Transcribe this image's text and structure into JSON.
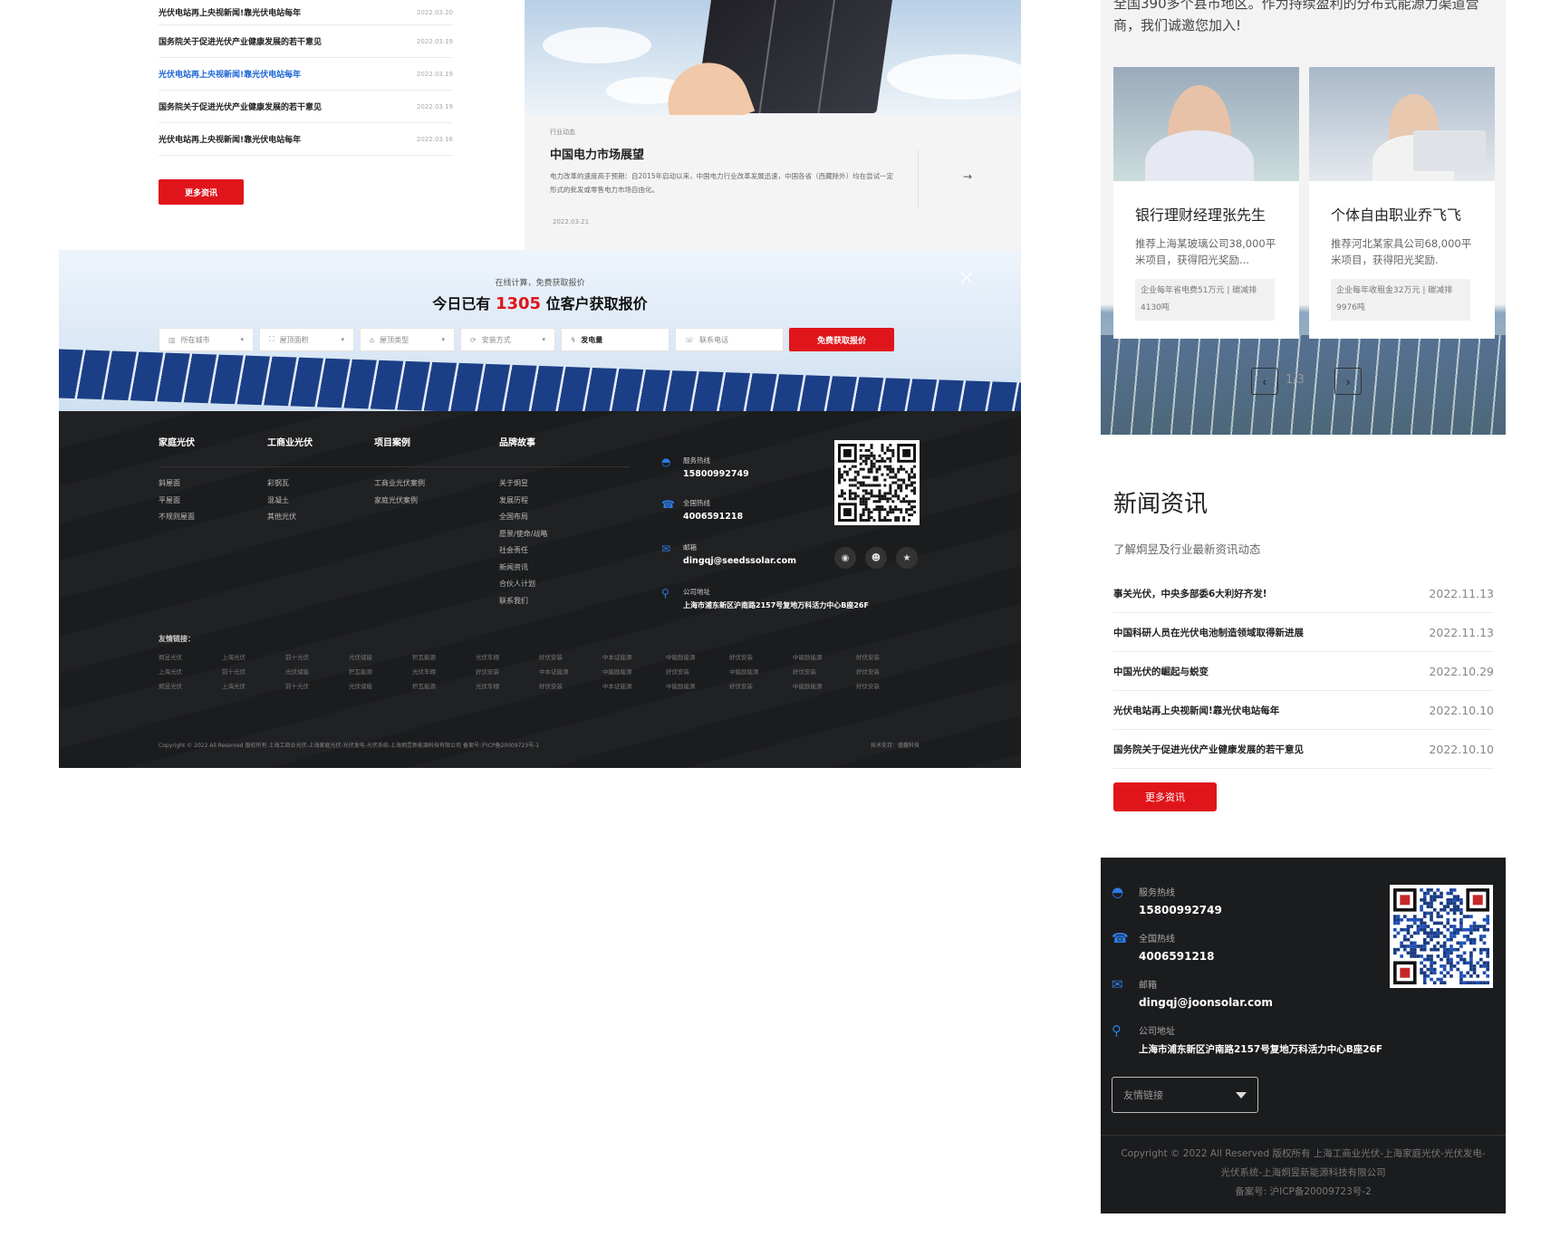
{
  "desktop": {
    "news_list": [
      {
        "title": "光伏电站再上央视新闻!靠光伏电站每年",
        "date": "2022.03.20",
        "active": false
      },
      {
        "title": "国务院关于促进光伏产业健康发展的若干意见",
        "date": "2022.03.19",
        "active": false
      },
      {
        "title": "光伏电站再上央视新闻!靠光伏电站每年",
        "date": "2022.03.19",
        "active": true
      },
      {
        "title": "国务院关于促进光伏产业健康发展的若干意见",
        "date": "2022.03.19",
        "active": false
      },
      {
        "title": "光伏电站再上央视新闻!靠光伏电站每年",
        "date": "2022.03.16",
        "active": false
      }
    ],
    "more_news_label": "更多资讯",
    "feature": {
      "tag": "行业动态",
      "title": "中国电力市场展望",
      "desc": "电力改革的速度高于预期：自2015年启动以来，中国电力行业改革发展迅速，中国各省（西藏除外）均在尝试一定形式的批发或零售电力市场自由化。",
      "arrow": "→",
      "date": "2022.03.21"
    },
    "quote": {
      "subtitle": "在线计算，免费获取报价",
      "title_prefix": "今日已有",
      "count": "1305",
      "title_suffix": "位客户获取报价",
      "close": "×",
      "fields": [
        {
          "icon": "▥",
          "label": "所在城市",
          "type": "select"
        },
        {
          "icon": "⛶",
          "label": "屋顶面积",
          "type": "select"
        },
        {
          "icon": "⌂",
          "label": "屋顶类型",
          "type": "select"
        },
        {
          "icon": "⟳",
          "label": "安装方式",
          "type": "select"
        },
        {
          "icon": "ϟ",
          "label": "发电量",
          "type": "text"
        },
        {
          "icon": "☏",
          "label": "联系电话",
          "type": "text"
        }
      ],
      "submit_label": "免费获取报价"
    },
    "footer": {
      "columns": [
        {
          "title": "家庭光伏",
          "items": [
            "斜屋面",
            "平屋面",
            "不规则屋面"
          ]
        },
        {
          "title": "工商业光伏",
          "items": [
            "彩钢瓦",
            "混凝土",
            "其他光伏"
          ]
        },
        {
          "title": "项目案例",
          "items": [
            "工商业光伏案例",
            "家庭光伏案例"
          ]
        },
        {
          "title": "品牌故事",
          "items": [
            "关于炯昱",
            "发展历程",
            "全国布局",
            "愿景/使命/战略",
            "社会责任",
            "新闻资讯",
            "合伙人计划",
            "联系我们"
          ]
        }
      ],
      "contacts": [
        {
          "icon": "headset-icon",
          "label": "服务热线",
          "value": "15800992749"
        },
        {
          "icon": "phone-icon",
          "label": "全国热线",
          "value": "4006591218"
        },
        {
          "icon": "mail-icon",
          "label": "邮箱",
          "value": "dingqj@seedssolar.com"
        },
        {
          "icon": "location-icon",
          "label": "公司地址",
          "value": "上海市浦东新区沪南路2157号复地万科活力中心B座26F"
        }
      ],
      "social": [
        "weibo-icon",
        "wechat-icon",
        "star-icon"
      ],
      "links_title": "友情链接：",
      "links": [
        "炯昱光伏",
        "上海光伏",
        "前十光伏",
        "光伏储能",
        "积瓦能源",
        "光伏车棚",
        "好伏安装",
        "中本证能源",
        "中能励能源",
        "好伏安装",
        "中能励能源",
        "好伏安装",
        "上海光伏",
        "前十光伏",
        "光伏储能",
        "积瓦能源",
        "光伏车棚",
        "好伏安装",
        "中本证能源",
        "中能励能源",
        "好伏安装",
        "中能励能源",
        "好伏安装",
        "好伏安装",
        "炯昱光伏",
        "上海光伏",
        "前十光伏",
        "光伏储能",
        "积瓦能源",
        "光伏车棚",
        "好伏安装",
        "中本证能源",
        "中能励能源",
        "好伏安装",
        "中能励能源",
        "好伏安装"
      ],
      "copyright": "Copyright © 2022 All Reserved 版权所有 上海工商业光伏-上海家庭光伏-光伏发电-光伏系统-上海炯昱新能源科技有限公司 备案号:沪ICP备20009723号-1",
      "tech": "技术支持：盛趣科技"
    }
  },
  "mobile": {
    "intro": "全国390多个县市地区。作为持续盈利的分布式能源力渠道营商，我们诚邀您加入!",
    "partners": [
      {
        "name": "银行理财经理张先生",
        "desc": "推荐上海某玻璃公司38,000平米项目，获得阳光奖励...",
        "tag": "企业每年省电费51万元 | 碳减排4130吨"
      },
      {
        "name": "个体自由职业乔飞飞",
        "desc": "推荐河北某家具公司68,000平米项目，获得阳光奖励.",
        "tag": "企业每年收租金32万元 | 碳减排9976吨"
      }
    ],
    "carousel": {
      "prev": "‹",
      "next": "›",
      "counter": "1/3"
    },
    "news": {
      "title": "新闻资讯",
      "subtitle": "了解炯昱及行业最新资讯动态",
      "items": [
        {
          "title": "事关光伏，中央多部委6大利好齐发!",
          "date": "2022.11.13"
        },
        {
          "title": "中国科研人员在光伏电池制造领域取得新进展",
          "date": "2022.11.13"
        },
        {
          "title": "中国光伏的崛起与蜕变",
          "date": "2022.10.29"
        },
        {
          "title": "光伏电站再上央视新闻!靠光伏电站每年",
          "date": "2022.10.10"
        },
        {
          "title": "国务院关于促进光伏产业健康发展的若干意见",
          "date": "2022.10.10"
        }
      ],
      "more_label": "更多资讯"
    },
    "footer": {
      "contacts": [
        {
          "icon": "headset-icon",
          "label": "服务热线",
          "value": "15800992749"
        },
        {
          "icon": "phone-icon",
          "label": "全国热线",
          "value": "4006591218"
        },
        {
          "icon": "mail-icon",
          "label": "邮箱",
          "value": "dingqj@joonsolar.com"
        },
        {
          "icon": "location-icon",
          "label": "公司地址",
          "value": "上海市浦东新区沪南路2157号复地万科活力中心B座26F"
        }
      ],
      "links_select": "友情链接",
      "copyright_1": "Copyright © 2022 All Reserved 版权所有 上海工商业光伏-上海家庭光伏-光伏发电-",
      "copyright_2": "光伏系统-上海炯昱新能源科技有限公司",
      "copyright_3": "备案号: 沪ICP备20009723号-2"
    }
  },
  "colors": {
    "accent_red": "#e0151b",
    "link_blue": "#1a64d6",
    "icon_blue": "#2c7be5",
    "footer_bg": "#1b1c1e"
  }
}
